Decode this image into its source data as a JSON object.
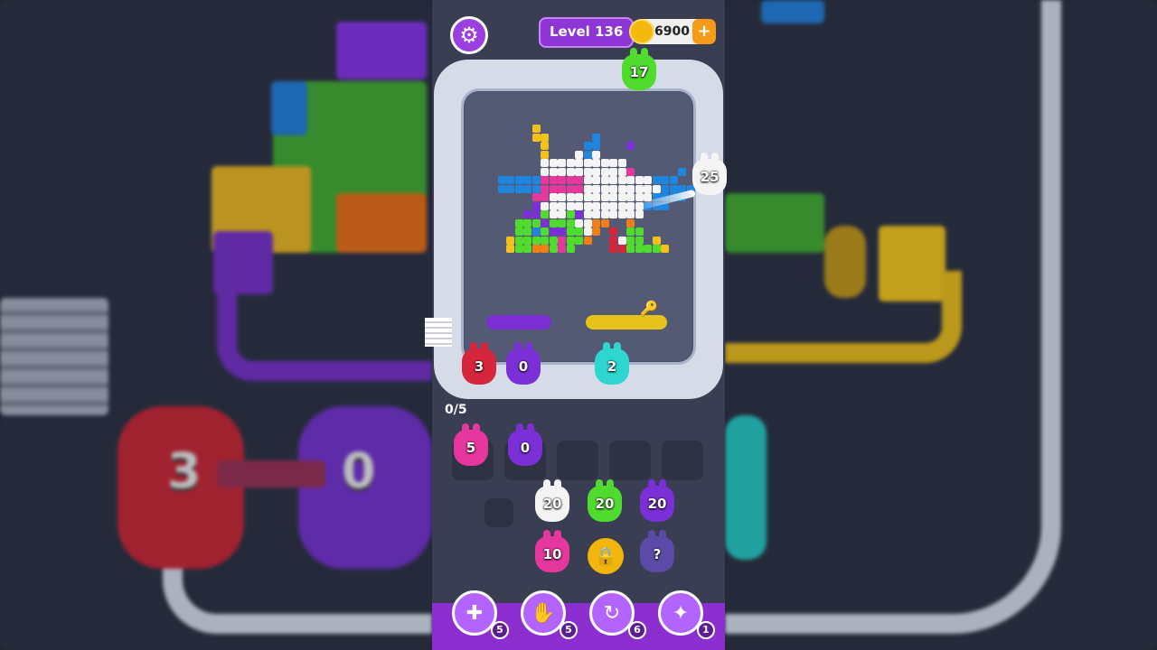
{
  "header": {
    "level_label": "Level 136",
    "coins": "6900",
    "add_coins": "+"
  },
  "conveyor": {
    "top_bunny": "17",
    "right_bunny": "25",
    "queue": [
      "3",
      "0",
      "2"
    ]
  },
  "holding": {
    "counter": "0/5",
    "slots": [
      "5",
      "0"
    ]
  },
  "tray": {
    "row1": [
      "20",
      "20",
      "20"
    ],
    "row2": [
      "10",
      "?"
    ]
  },
  "boosters": [
    {
      "icon": "add-slot-icon",
      "count": "5"
    },
    {
      "icon": "hand-icon",
      "count": "5"
    },
    {
      "icon": "shuffle-icon",
      "count": "6"
    },
    {
      "icon": "bunny-magic-icon",
      "count": "1"
    }
  ],
  "background": {
    "left_numbers": [
      "3",
      "0"
    ]
  },
  "colors": {
    "red": "#d6263c",
    "purple": "#7b2fd6",
    "cyan": "#2fd6d0",
    "green": "#4fdc2e",
    "white": "#f4f4f4",
    "pink": "#e6379e",
    "yellow": "#f2c21a",
    "blue": "#1f86e0",
    "orange": "#f17f16"
  }
}
